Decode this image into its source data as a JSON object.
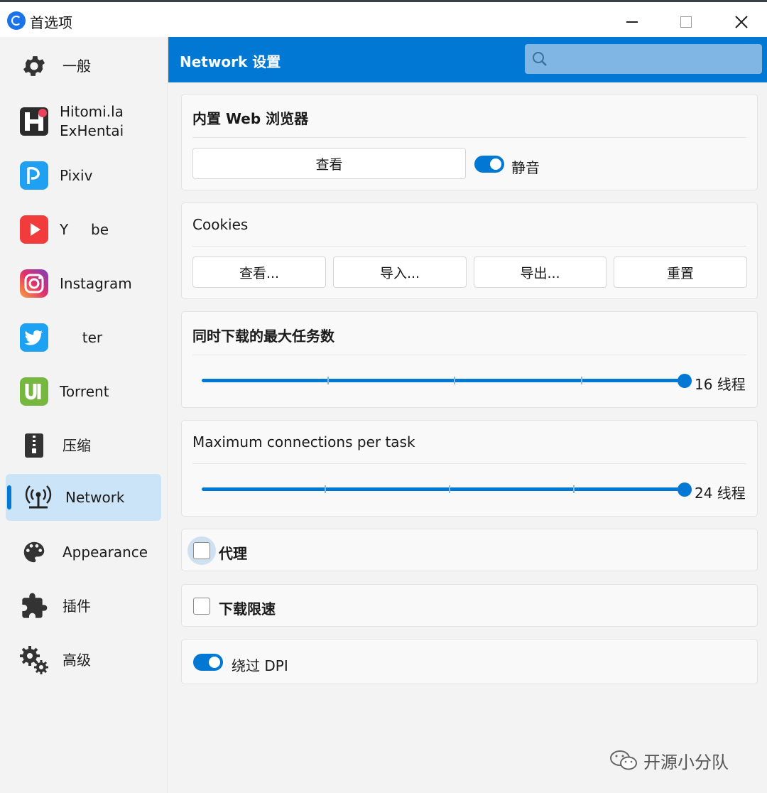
{
  "window": {
    "title": "首选项",
    "controls": {
      "minimize": "minimize-icon",
      "maximize": "maximize-icon",
      "close": "close-icon"
    }
  },
  "sidebar": {
    "items": [
      {
        "label": "一般",
        "icon": "gear-icon",
        "active": false
      },
      {
        "label": "Hitomi.la\nExHentai",
        "icon": "hitomi-logo-icon",
        "active": false
      },
      {
        "label": "Pixiv",
        "icon": "pixiv-logo-icon",
        "active": false
      },
      {
        "label": "Y     be",
        "icon": "youtube-logo-icon",
        "active": false
      },
      {
        "label": "Instagram",
        "icon": "instagram-logo-icon",
        "active": false
      },
      {
        "label": "     ter",
        "icon": "twitter-logo-icon",
        "active": false
      },
      {
        "label": "Torrent",
        "icon": "utorrent-logo-icon",
        "active": false
      },
      {
        "label": "压缩",
        "icon": "zip-icon",
        "active": false
      },
      {
        "label": "Network",
        "icon": "network-antenna-icon",
        "active": true
      },
      {
        "label": "Appearance",
        "icon": "palette-icon",
        "active": false
      },
      {
        "label": "插件",
        "icon": "puzzle-icon",
        "active": false
      },
      {
        "label": "高级",
        "icon": "gears-icon",
        "active": false
      }
    ]
  },
  "header": {
    "title": "Network 设置",
    "search": {
      "placeholder": "",
      "icon": "search-icon"
    }
  },
  "browser_card": {
    "title": "内置 Web 浏览器",
    "view_button": "查看",
    "mute_label": "静音",
    "mute_on": true
  },
  "cookies_card": {
    "title": "Cookies",
    "buttons": [
      "查看...",
      "导入...",
      "导出...",
      "重置"
    ]
  },
  "max_tasks_card": {
    "title": "同时下载的最大任务数",
    "value_text": "16  线程",
    "level": 1.0
  },
  "max_connections_card": {
    "title": "Maximum connections per task",
    "value_text": "24  线程",
    "level": 1.0
  },
  "proxy_card": {
    "label": "代理",
    "checked": false
  },
  "speed_limit_card": {
    "label": "下载限速",
    "checked": false
  },
  "dpi_card": {
    "label": "绕过 DPI",
    "on": true
  },
  "watermark": {
    "text": "开源小分队",
    "icon": "wechat-icon"
  },
  "colors": {
    "accent": "#0078d4",
    "active_nav": "#cce4f7",
    "search_bg": "#7fb6e4"
  }
}
